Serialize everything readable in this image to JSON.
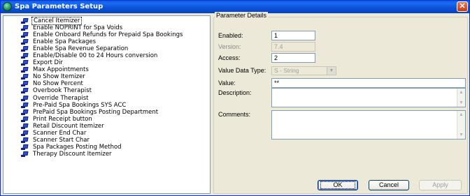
{
  "window": {
    "title": "Spa Parameters Setup",
    "close_glyph": "✕"
  },
  "tree": {
    "items": [
      {
        "label": "Cancel Itemizer",
        "selected": true
      },
      {
        "label": "Enable NOPRINT for Spa Voids"
      },
      {
        "label": "Enable Onboard Refunds for Prepaid Spa Bookings"
      },
      {
        "label": "Enable Spa Packages"
      },
      {
        "label": "Enable Spa Revenue Separation"
      },
      {
        "label": "Enable/Disable 00 to 24 Hours conversion"
      },
      {
        "label": "Export Dir"
      },
      {
        "label": "Max Appointments"
      },
      {
        "label": "No Show Itemizer"
      },
      {
        "label": "No Show Percent"
      },
      {
        "label": "Overbook Therapist"
      },
      {
        "label": "Override Therapist"
      },
      {
        "label": "Pre-Paid Spa Bookings SYS ACC"
      },
      {
        "label": "PrePaid Spa Bookings Posting Department"
      },
      {
        "label": "Print Receipt button"
      },
      {
        "label": "Retail Discount Itemizer"
      },
      {
        "label": "Scanner End Char"
      },
      {
        "label": "Scanner Start Char"
      },
      {
        "label": "Spa Packages Posting Method"
      },
      {
        "label": "Therapy Discount Itemizer"
      }
    ]
  },
  "details": {
    "group_title": "Parameter Details",
    "enabled_label": "Enabled:",
    "enabled_value": "1",
    "version_label": "Version:",
    "version_value": "7.4",
    "access_label": "Access:",
    "access_value": "2",
    "value_type_label": "Value Data Type:",
    "value_type_value": "S - String",
    "value_label": "Value:",
    "value_value": "**",
    "description_label": "Description:",
    "description_value": "",
    "comments_label": "Comments:",
    "comments_value": ""
  },
  "buttons": {
    "ok": "OK",
    "cancel": "Cancel",
    "apply": "Apply"
  },
  "icons": {
    "tree_node": "parameter-node-icon",
    "combo_arrow": "▼",
    "scroll_up": "▲",
    "scroll_down": "▼"
  }
}
